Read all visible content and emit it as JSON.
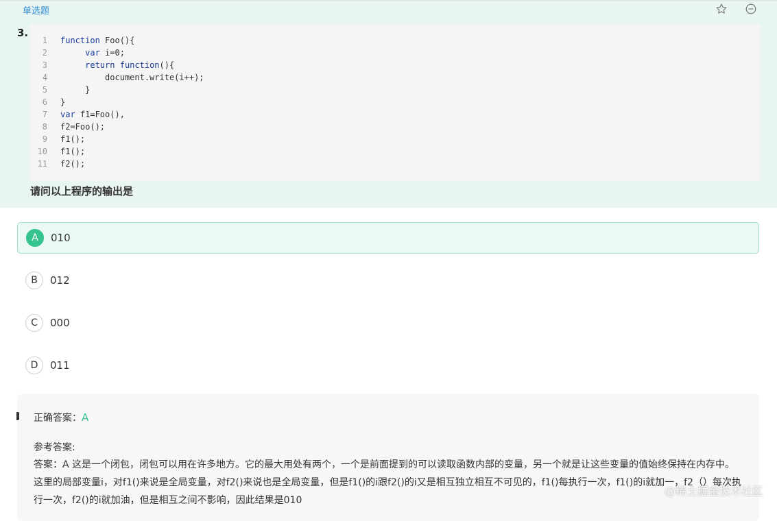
{
  "question": {
    "type_tag": "单选题",
    "number": "3.",
    "code_lines": [
      {
        "n": "1",
        "parts": [
          {
            "t": "function",
            "kw": true
          },
          {
            "t": " Foo(){",
            "kw": false
          }
        ]
      },
      {
        "n": "2",
        "parts": [
          {
            "t": "     ",
            "kw": false
          },
          {
            "t": "var",
            "kw": true
          },
          {
            "t": " i=0;",
            "kw": false
          }
        ]
      },
      {
        "n": "3",
        "parts": [
          {
            "t": "     ",
            "kw": false
          },
          {
            "t": "return",
            "kw": true
          },
          {
            "t": " ",
            "kw": false
          },
          {
            "t": "function",
            "kw": true
          },
          {
            "t": "(){",
            "kw": false
          }
        ]
      },
      {
        "n": "4",
        "parts": [
          {
            "t": "         document.write(i++);",
            "kw": false
          }
        ]
      },
      {
        "n": "5",
        "parts": [
          {
            "t": "     }",
            "kw": false
          }
        ]
      },
      {
        "n": "6",
        "parts": [
          {
            "t": "}",
            "kw": false
          }
        ]
      },
      {
        "n": "7",
        "parts": [
          {
            "t": "var",
            "kw": true
          },
          {
            "t": " f1=Foo(),",
            "kw": false
          }
        ]
      },
      {
        "n": "8",
        "parts": [
          {
            "t": "f2=Foo();",
            "kw": false
          }
        ]
      },
      {
        "n": "9",
        "parts": [
          {
            "t": "f1();",
            "kw": false
          }
        ]
      },
      {
        "n": "10",
        "parts": [
          {
            "t": "f1();",
            "kw": false
          }
        ]
      },
      {
        "n": "11",
        "parts": [
          {
            "t": "f2();",
            "kw": false
          }
        ]
      }
    ],
    "prompt": "请问以上程序的输出是"
  },
  "toolbar": {
    "favorite_icon": "star-icon",
    "collapse_icon": "minus-circle-icon"
  },
  "options": [
    {
      "letter": "A",
      "text": "010",
      "selected": true
    },
    {
      "letter": "B",
      "text": "012",
      "selected": false
    },
    {
      "letter": "C",
      "text": "000",
      "selected": false
    },
    {
      "letter": "D",
      "text": "011",
      "selected": false
    }
  ],
  "answer": {
    "correct_label": "正确答案：",
    "correct_value": "A",
    "reference_title": "参考答案:",
    "explanation": "答案：A 这是一个闭包，闭包可以用在许多地方。它的最大用处有两个，一个是前面提到的可以读取函数内部的变量，另一个就是让这些变量的值始终保持在内存中。 这里的局部变量i，对f1()来说是全局变量，对f2()来说也是全局变量，但是f1()的i跟f2()的i又是相互独立相互不可见的，f1()每执行一次，f1()的i就加一，f2（）每次执行一次，f2()的i就加油，但是相互之间不影响，因此结果是010"
  },
  "watermark": "@稀土掘金技术社区",
  "colors": {
    "accent_green": "#35c48f",
    "question_bg": "#e9f5f2",
    "link_blue": "#2f8cd4"
  }
}
